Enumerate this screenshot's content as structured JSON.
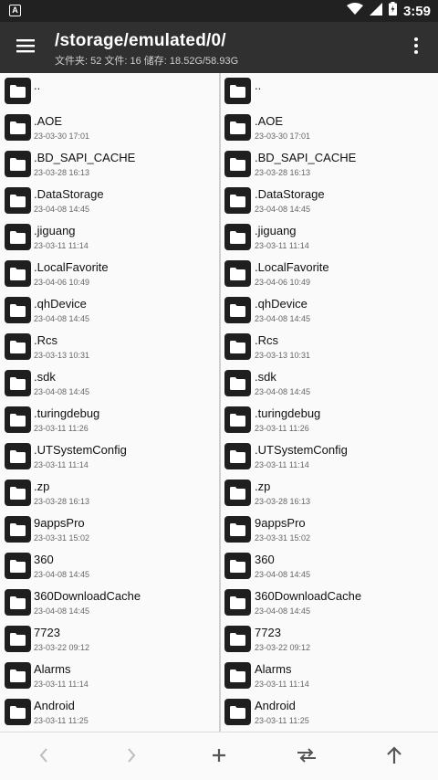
{
  "status_bar": {
    "app_badge": "A",
    "time": "3:59"
  },
  "app_bar": {
    "path": "/storage/emulated/0/",
    "info": "文件夹: 52  文件: 16  储存: 18.52G/58.93G"
  },
  "panes": [
    {
      "items": [
        {
          "name": "..",
          "date": ""
        },
        {
          "name": ".AOE",
          "date": "23-03-30 17:01"
        },
        {
          "name": ".BD_SAPI_CACHE",
          "date": "23-03-28 16:13"
        },
        {
          "name": ".DataStorage",
          "date": "23-04-08 14:45"
        },
        {
          "name": ".jiguang",
          "date": "23-03-11 11:14"
        },
        {
          "name": ".LocalFavorite",
          "date": "23-04-06 10:49"
        },
        {
          "name": ".qhDevice",
          "date": "23-04-08 14:45"
        },
        {
          "name": ".Rcs",
          "date": "23-03-13 10:31"
        },
        {
          "name": ".sdk",
          "date": "23-04-08 14:45"
        },
        {
          "name": ".turingdebug",
          "date": "23-03-11 11:26"
        },
        {
          "name": ".UTSystemConfig",
          "date": "23-03-11 11:14"
        },
        {
          "name": ".zp",
          "date": "23-03-28 16:13"
        },
        {
          "name": "9appsPro",
          "date": "23-03-31 15:02"
        },
        {
          "name": "360",
          "date": "23-04-08 14:45"
        },
        {
          "name": "360DownloadCache",
          "date": "23-04-08 14:45"
        },
        {
          "name": "7723",
          "date": "23-03-22 09:12"
        },
        {
          "name": "Alarms",
          "date": "23-03-11 11:14"
        },
        {
          "name": "Android",
          "date": "23-03-11 11:25"
        }
      ]
    },
    {
      "items": [
        {
          "name": "..",
          "date": ""
        },
        {
          "name": ".AOE",
          "date": "23-03-30 17:01"
        },
        {
          "name": ".BD_SAPI_CACHE",
          "date": "23-03-28 16:13"
        },
        {
          "name": ".DataStorage",
          "date": "23-04-08 14:45"
        },
        {
          "name": ".jiguang",
          "date": "23-03-11 11:14"
        },
        {
          "name": ".LocalFavorite",
          "date": "23-04-06 10:49"
        },
        {
          "name": ".qhDevice",
          "date": "23-04-08 14:45"
        },
        {
          "name": ".Rcs",
          "date": "23-03-13 10:31"
        },
        {
          "name": ".sdk",
          "date": "23-04-08 14:45"
        },
        {
          "name": ".turingdebug",
          "date": "23-03-11 11:26"
        },
        {
          "name": ".UTSystemConfig",
          "date": "23-03-11 11:14"
        },
        {
          "name": ".zp",
          "date": "23-03-28 16:13"
        },
        {
          "name": "9appsPro",
          "date": "23-03-31 15:02"
        },
        {
          "name": "360",
          "date": "23-04-08 14:45"
        },
        {
          "name": "360DownloadCache",
          "date": "23-04-08 14:45"
        },
        {
          "name": "7723",
          "date": "23-03-22 09:12"
        },
        {
          "name": "Alarms",
          "date": "23-03-11 11:14"
        },
        {
          "name": "Android",
          "date": "23-03-11 11:25"
        }
      ]
    }
  ],
  "bottom_bar": {
    "buttons": [
      {
        "icon": "back-icon",
        "enabled": false
      },
      {
        "icon": "forward-icon",
        "enabled": false
      },
      {
        "icon": "add-icon",
        "enabled": true
      },
      {
        "icon": "swap-icon",
        "enabled": true
      },
      {
        "icon": "up-icon",
        "enabled": true
      }
    ]
  },
  "colors": {
    "app_bar": "#303030",
    "status_bar": "#212121",
    "folder_icon": "#1f1f1f",
    "disabled": "#bdbdbd",
    "enabled": "#555555"
  }
}
